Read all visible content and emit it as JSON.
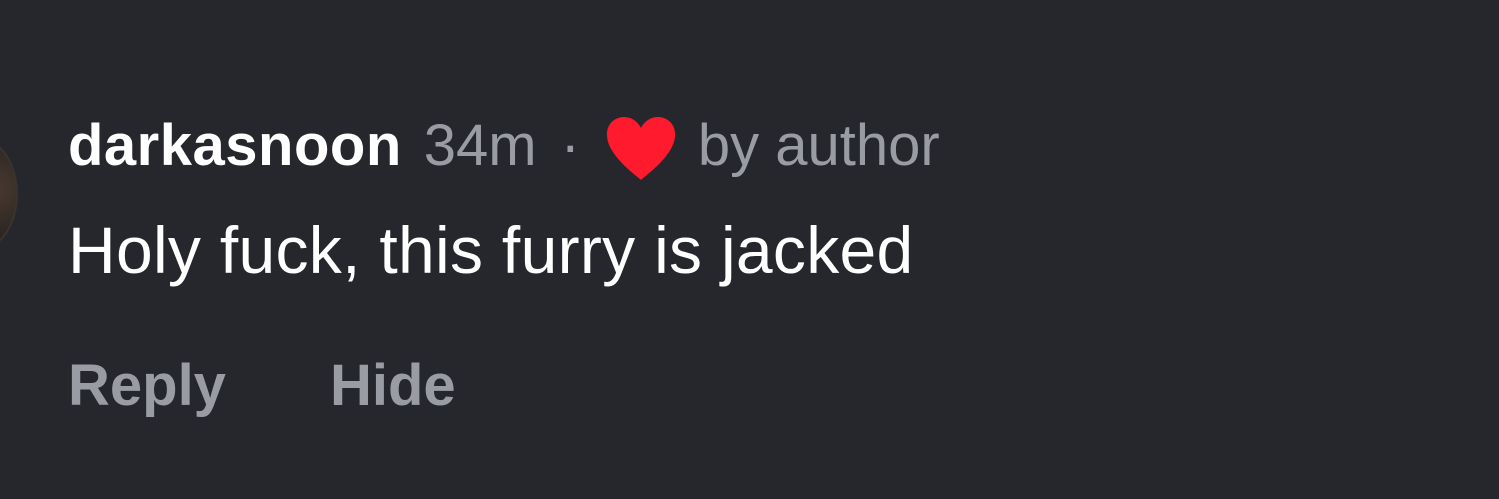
{
  "comment": {
    "username": "darkasnoon",
    "time": "34m",
    "separator": "·",
    "liked_icon": "heart-icon",
    "liked_by_label": "by author",
    "text": "Holy fuck, this furry is jacked",
    "actions": {
      "reply": "Reply",
      "hide": "Hide"
    }
  },
  "colors": {
    "background": "#26272c",
    "primary_text": "#ffffff",
    "secondary_text": "#9a9ca3",
    "heart": "#ff1a2e"
  }
}
